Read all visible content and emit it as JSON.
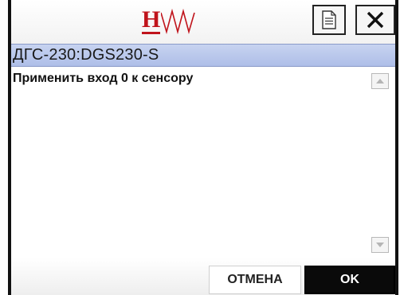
{
  "header": {
    "logo_letter": "H",
    "doc_icon": "document-icon",
    "close_icon": "close-icon"
  },
  "window": {
    "title": "ДГС-230:DGS230-S"
  },
  "content": {
    "message": "Применить вход 0 к сенсору"
  },
  "footer": {
    "cancel_label": "ОТМЕНА",
    "ok_label": "OK"
  },
  "colors": {
    "logo": "#c0141c",
    "titlebar": "#b8c6ec",
    "ok_button": "#0a0a0a"
  }
}
